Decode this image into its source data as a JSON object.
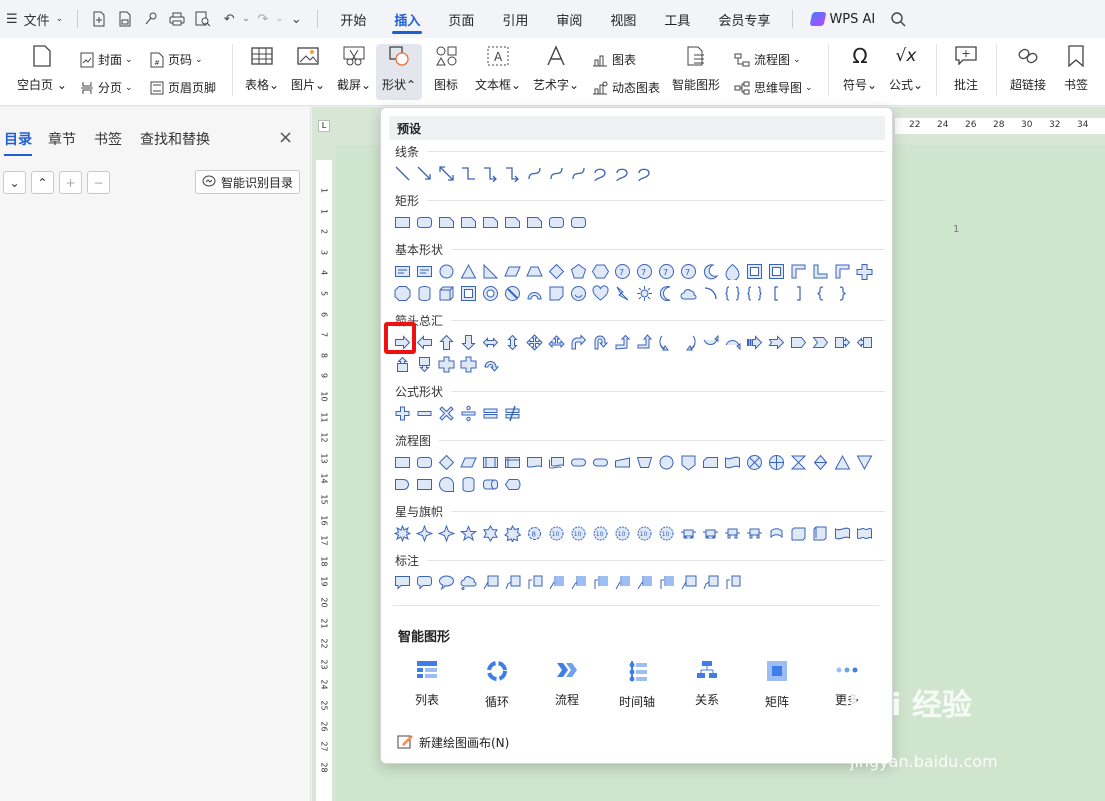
{
  "menubar": {
    "file_label": "文件",
    "tabs": [
      {
        "label": "开始"
      },
      {
        "label": "插入"
      },
      {
        "label": "页面"
      },
      {
        "label": "引用"
      },
      {
        "label": "审阅"
      },
      {
        "label": "视图"
      },
      {
        "label": "工具"
      },
      {
        "label": "会员专享"
      }
    ],
    "ai_label": "WPS AI"
  },
  "ribbon": {
    "blank_page": "空白页",
    "cover": "封面",
    "page_break": "分页",
    "page_number": "页码",
    "header_footer": "页眉页脚",
    "table": "表格",
    "picture": "图片",
    "screenshot": "截屏",
    "shape": "形状",
    "icon": "图标",
    "textbox": "文本框",
    "wordart": "艺术字",
    "chart": "图表",
    "dynamic_chart": "动态图表",
    "smart_graphic": "智能图形",
    "flowchart": "流程图",
    "mindmap": "思维导图",
    "symbol": "符号",
    "formula": "公式",
    "comment": "批注",
    "hyperlink": "超链接",
    "bookmark": "书签"
  },
  "nav": {
    "tabs": [
      {
        "label": "目录"
      },
      {
        "label": "章节"
      },
      {
        "label": "书签"
      },
      {
        "label": "查找和替换"
      }
    ],
    "smart_toc": "智能识别目录"
  },
  "shapes_panel": {
    "presets": "预设",
    "sections": {
      "lines": "线条",
      "rect": "矩形",
      "basic": "基本形状",
      "arrows": "箭头总汇",
      "formula": "公式形状",
      "flow": "流程图",
      "stars": "星与旗帜",
      "callouts": "标注"
    },
    "smart_title": "智能图形",
    "smart_items": [
      {
        "label": "列表"
      },
      {
        "label": "循环"
      },
      {
        "label": "流程"
      },
      {
        "label": "时间轴"
      },
      {
        "label": "关系"
      },
      {
        "label": "矩阵"
      },
      {
        "label": "更多"
      }
    ],
    "new_canvas": "新建绘图画布(N)"
  },
  "ruler": {
    "h_numbers": [
      "22",
      "24",
      "26",
      "28",
      "30",
      "32",
      "34"
    ],
    "v_numbers": [
      "1",
      "1",
      "2",
      "3",
      "4",
      "5",
      "6",
      "7",
      "8",
      "9",
      "10",
      "11",
      "12",
      "13",
      "14",
      "15",
      "16",
      "17",
      "18",
      "19",
      "20",
      "21",
      "22",
      "23",
      "24",
      "25",
      "26",
      "27",
      "28"
    ]
  },
  "document": {
    "page_number": "1"
  },
  "watermark": {
    "brand": "Bai 经验",
    "url": "jingyan.baidu.com"
  },
  "colors": {
    "accent": "#1f5fd6",
    "shape_stroke": "#3a64b8",
    "shape_fill": "#dfe8f7",
    "highlight": "#ee1111",
    "doc_bg": "#cfe5cd"
  }
}
